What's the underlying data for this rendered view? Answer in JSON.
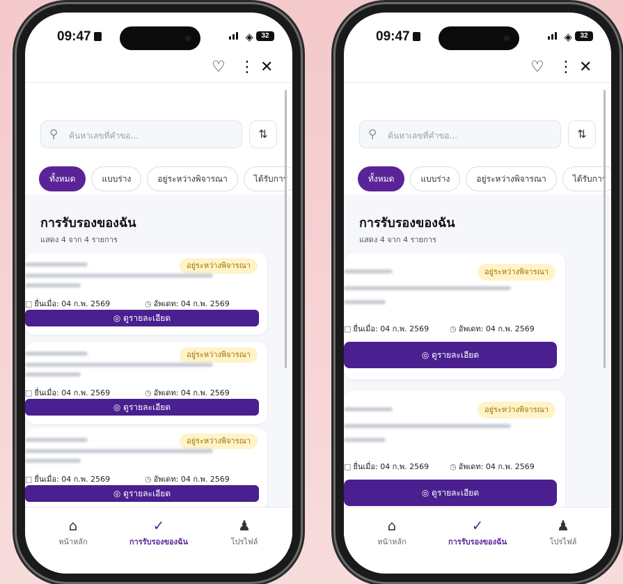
{
  "status": {
    "time": "09:47",
    "battery": "32"
  },
  "topbar": {
    "heart_icon": "heart-icon",
    "more_icon": "more-vertical-icon",
    "close_icon": "close-icon"
  },
  "search": {
    "placeholder": "ค้นหาเลขที่คำขอ..."
  },
  "filters": [
    "ทั้งหมด",
    "แบบร่าง",
    "อยู่ระหว่างพิจารณา",
    "ได้รับการ"
  ],
  "section": {
    "title": "การรับรองของฉัน",
    "subtitle": "แสดง 4 จาก 4 รายการ"
  },
  "card": {
    "badge": "อยู่ระหว่างพิจารณา",
    "submitted": "ยื่นเมื่อ: 04 ก.พ. 2569",
    "updated": "อัพเดท: 04 ก.พ. 2569",
    "view_label": "ดูรายละเอียด"
  },
  "nav": {
    "home": "หน้าหลัก",
    "mine": "การรับรองของฉัน",
    "profile": "โปรไฟล์"
  },
  "colors": {
    "accent": "#5a2398",
    "badge_bg": "#fff3c8",
    "badge_text": "#a07100"
  }
}
